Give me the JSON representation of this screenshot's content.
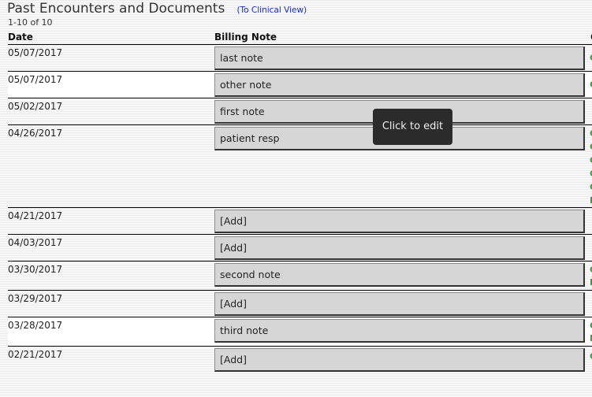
{
  "header": {
    "title": "Past Encounters and Documents",
    "clinical_link": "(To Clinical View)",
    "count": "1-10 of 10"
  },
  "table": {
    "columns": [
      "Date",
      "Billing Note",
      "C"
    ],
    "rows": [
      {
        "date": "05/07/2017",
        "note": "last note"
      },
      {
        "date": "05/07/2017",
        "note": "other note"
      },
      {
        "date": "05/02/2017",
        "note": "first note"
      },
      {
        "date": "04/26/2017",
        "note": "patient resp"
      },
      {
        "date": "04/21/2017",
        "note": "[Add]"
      },
      {
        "date": "04/03/2017",
        "note": "[Add]"
      },
      {
        "date": "03/30/2017",
        "note": "second note"
      },
      {
        "date": "03/29/2017",
        "note": "[Add]"
      },
      {
        "date": "03/28/2017",
        "note": "third note"
      },
      {
        "date": "02/21/2017",
        "note": "[Add]"
      }
    ]
  },
  "side_marks": {
    "r0": "C",
    "r1": "C",
    "r3a": "C",
    "r3b": "C",
    "r3c": "C",
    "r3d": "C",
    "r3e": "C",
    "r3f": "I",
    "r6a": "C",
    "r6b": "I",
    "r8a": "C",
    "r8b": "I",
    "r9": "C"
  },
  "tooltip": {
    "text": "Click to edit"
  }
}
